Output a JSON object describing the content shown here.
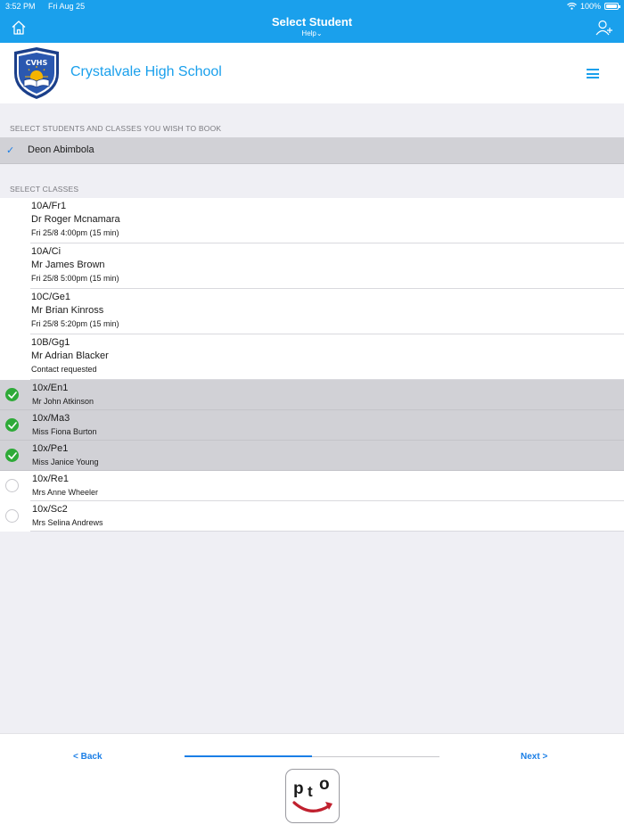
{
  "status": {
    "time": "3:52 PM",
    "date": "Fri Aug 25",
    "battery": "100%",
    "battery_level": 1.0
  },
  "nav": {
    "title": "Select Student",
    "help": "Help⌄"
  },
  "school": {
    "name": "Crystalvale High School",
    "crest_text": "CVHS"
  },
  "students": {
    "label": "SELECT STUDENTS AND CLASSES YOU WISH TO BOOK",
    "items": [
      {
        "name": "Deon Abimbola",
        "checked": true
      }
    ]
  },
  "classes": {
    "label": "SELECT CLASSES",
    "booked": [
      {
        "code": "10A/Fr1",
        "teacher": "Dr Roger Mcnamara",
        "detail": "Fri 25/8 4:00pm (15 min)"
      },
      {
        "code": "10A/Ci",
        "teacher": "Mr James Brown",
        "detail": "Fri 25/8 5:00pm (15 min)"
      },
      {
        "code": "10C/Ge1",
        "teacher": "Mr Brian Kinross",
        "detail": "Fri 25/8 5:20pm (15 min)"
      },
      {
        "code": "10B/Gg1",
        "teacher": "Mr Adrian Blacker",
        "detail": "Contact requested"
      }
    ],
    "selectable": [
      {
        "code": "10x/En1",
        "teacher": "Mr John Atkinson",
        "selected": true
      },
      {
        "code": "10x/Ma3",
        "teacher": "Miss Fiona Burton",
        "selected": true
      },
      {
        "code": "10x/Pe1",
        "teacher": "Miss Janice Young",
        "selected": true
      },
      {
        "code": "10x/Re1",
        "teacher": "Mrs Anne Wheeler",
        "selected": false
      },
      {
        "code": "10x/Sc2",
        "teacher": "Mrs Selina Andrews",
        "selected": false
      }
    ]
  },
  "footer": {
    "back": "< Back",
    "next": "Next >",
    "progress": 0.5,
    "logo_p": "p",
    "logo_t": "t",
    "logo_o": "o"
  },
  "colors": {
    "accent": "#1aa0ec",
    "link": "#1a7ee6",
    "selected_check": "#2eaa38"
  }
}
